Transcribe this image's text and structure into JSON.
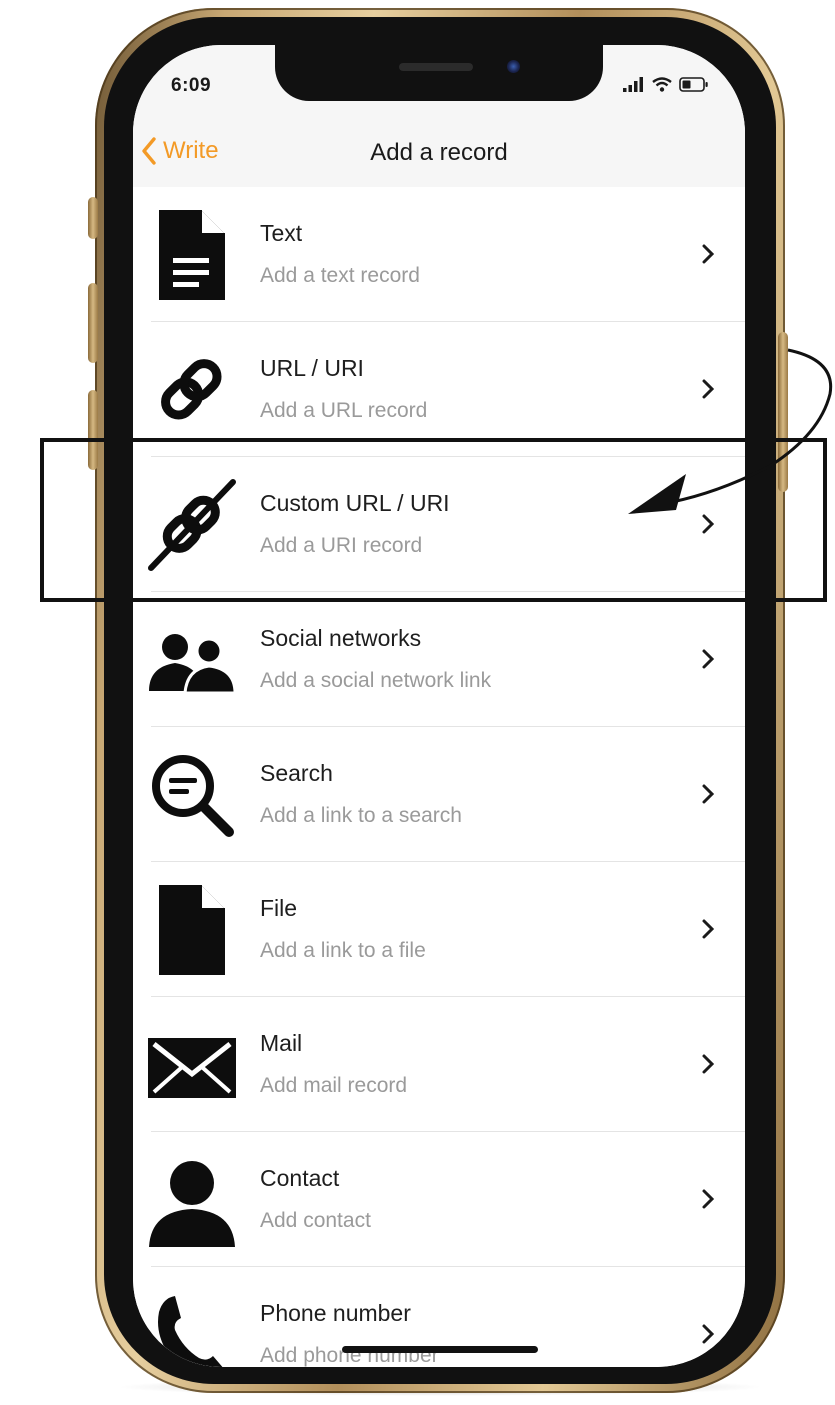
{
  "status_bar": {
    "time": "6:09",
    "icons": [
      "cellular-signal-icon",
      "wifi-icon",
      "battery-icon"
    ]
  },
  "nav": {
    "back_label": "Write",
    "title": "Add a record"
  },
  "records": [
    {
      "title": "Text",
      "subtitle": "Add a text record",
      "icon": "text-document-icon"
    },
    {
      "title": "URL / URI",
      "subtitle": "Add a URL record",
      "icon": "link-icon"
    },
    {
      "title": "Custom URL / URI",
      "subtitle": "Add a URI record",
      "icon": "broken-link-icon"
    },
    {
      "title": "Social networks",
      "subtitle": "Add a social network link",
      "icon": "people-icon"
    },
    {
      "title": "Search",
      "subtitle": "Add a link to a search",
      "icon": "search-icon"
    },
    {
      "title": "File",
      "subtitle": "Add a link to a file",
      "icon": "file-icon"
    },
    {
      "title": "Mail",
      "subtitle": "Add mail record",
      "icon": "mail-icon"
    },
    {
      "title": "Contact",
      "subtitle": "Add contact",
      "icon": "contact-icon"
    },
    {
      "title": "Phone number",
      "subtitle": "Add phone number",
      "icon": "phone-icon"
    }
  ],
  "colors": {
    "accent": "#f39a26",
    "bar_background": "#f6f6f6",
    "phone_frame": "#c8a874",
    "annotation": "#111111"
  }
}
